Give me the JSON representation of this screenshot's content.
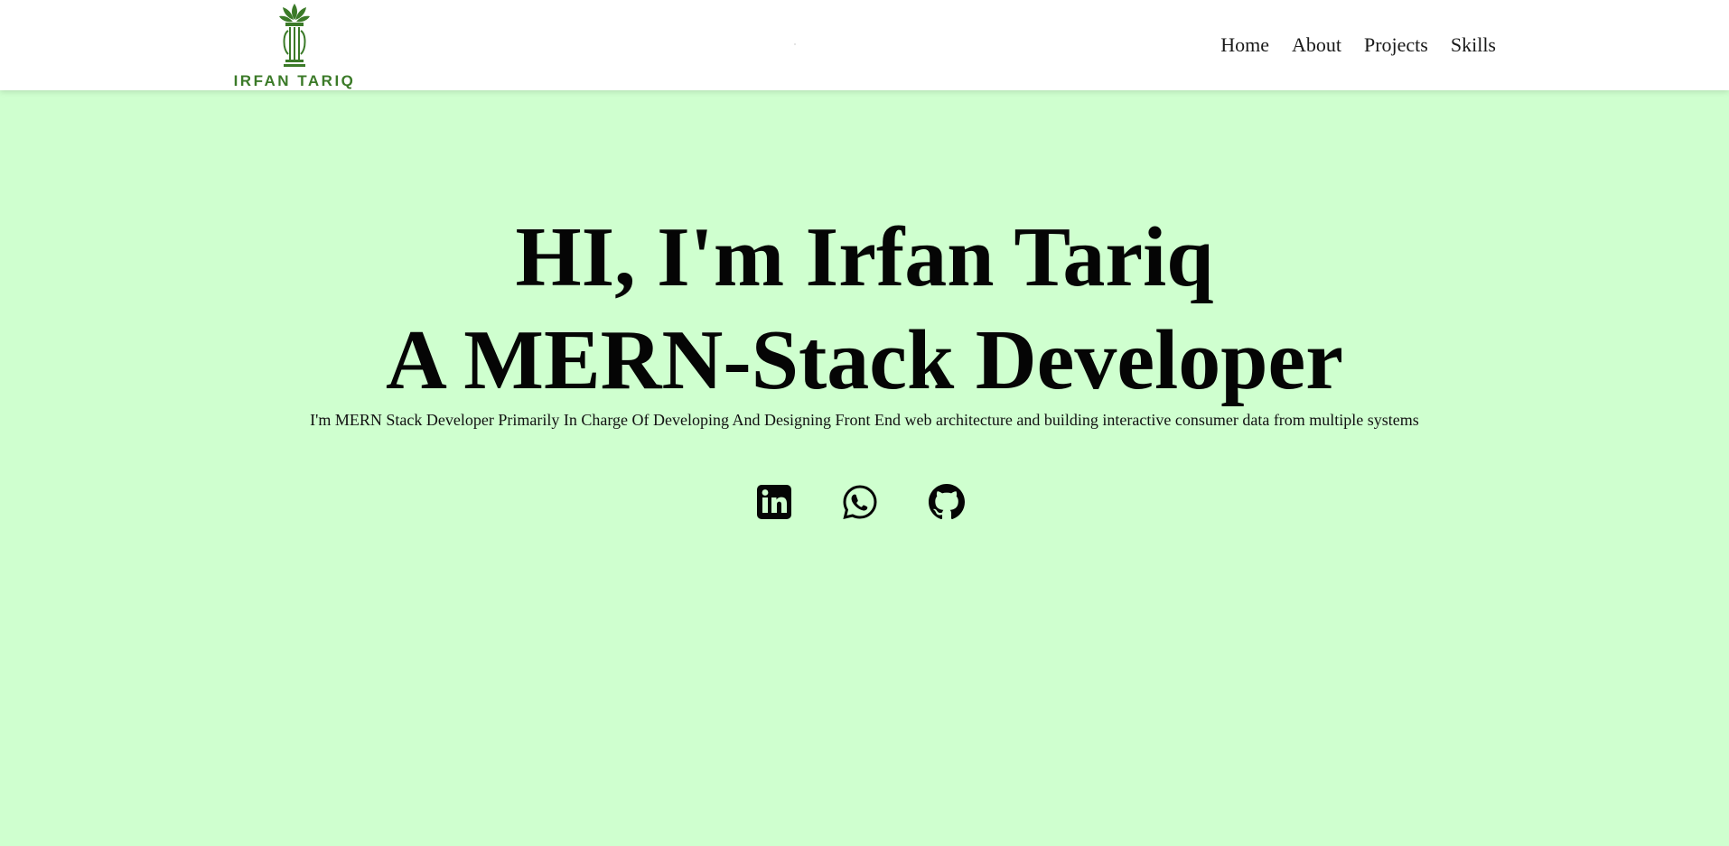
{
  "brand": {
    "name": "IRFAN TARIQ",
    "accent_color": "#3b7a28",
    "logo_icon": "pillar-leaf-logo-icon"
  },
  "nav": {
    "items": [
      {
        "label": "Home"
      },
      {
        "label": "About"
      },
      {
        "label": "Projects"
      },
      {
        "label": "Skills"
      }
    ]
  },
  "hero": {
    "background_color": "#cfffcf",
    "title_line_1": "HI, I'm Irfan Tariq",
    "title_line_2": "A MERN-Stack Developer",
    "tagline": "I'm MERN Stack Developer Primarily In Charge Of Developing And Designing Front End web architecture and building interactive consumer data from multiple systems",
    "socials": [
      {
        "icon": "linkedin-icon"
      },
      {
        "icon": "whatsapp-icon"
      },
      {
        "icon": "github-icon"
      }
    ]
  }
}
